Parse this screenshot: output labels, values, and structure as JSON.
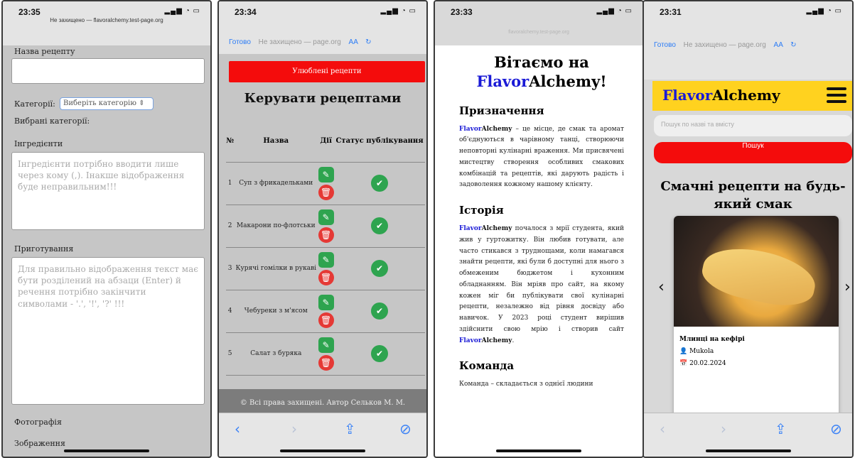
{
  "phone1": {
    "time": "23:35",
    "url": "Не захищено — flavoralchemy.test-page.org",
    "recipe_name_label": "Назва рецепту",
    "category_label": "Категорії:",
    "category_select": "Виберіть категорію",
    "selected_categories_label": "Вибрані категорії:",
    "ingredients_label": "Інгредієнти",
    "ingredients_placeholder": "Інгредієнти потрібно вводити лише через кому (,). Інакше відображення буде неправильним!!!",
    "preparation_label": "Приготування",
    "preparation_placeholder": "Для правильно відображення текст має бути розділений на абзаци (Enter) й речення потрібно закінчити символами - '.', '!', '?' !!!",
    "photo_label": "Фотографія",
    "image_label": "Зображення"
  },
  "phone2": {
    "time": "23:34",
    "done": "Готово",
    "url": "Не захищено — page.org",
    "aa": "AA",
    "favorites_button": "Улюблені рецепти",
    "title": "Керувати рецептами",
    "headers": [
      "№",
      "Назва",
      "Дії",
      "Статус публікування"
    ],
    "rows": [
      {
        "n": "1",
        "name": "Суп з фрикадельками"
      },
      {
        "n": "2",
        "name": "Макарони по-флотськи"
      },
      {
        "n": "3",
        "name": "Курячі гомілки в рукаві"
      },
      {
        "n": "4",
        "name": "Чебуреки з м'ясом"
      },
      {
        "n": "5",
        "name": "Салат з буряка"
      }
    ],
    "footer": "© Всі права захищені. Автор Сельков М. М."
  },
  "phone3": {
    "time": "23:33",
    "url": "flavoralchemy.test-page.org",
    "welcome": "Вітаємо на",
    "brand_flavor": "Flavor",
    "brand_alchemy": "Alchemy!",
    "purpose_heading": "Призначення",
    "purpose_text": " – це місце, де смак та аромат об'єднуються в чарівному танці, створюючи неповторні кулінарні враження. Ми присвячені мистецтву створення особливих смакових комбінацій та рецептів, які дарують радість і задоволення кожному нашому клієнту.",
    "history_heading": "Історія",
    "history_text_1": " почалося з мрії студента, який жив у гуртожитку. Він любив готувати, але часто стикався з труднощами, коли намагався знайти рецепти, які були б доступні для нього з обмеженим бюджетом і кухонним обладнанням. Він мріяв про сайт, на якому кожен міг би публікувати свої кулінарні рецепти, незалежно від рівня досвіду або навичок. У 2023 році студент вирішив здійснити свою мрію і створив сайт ",
    "history_text_2": ".",
    "team_heading": "Команда",
    "team_text": "Команда – складається з однієї людини",
    "brand_flavor_short": "Flavor",
    "brand_alchemy_short": "Alchemy"
  },
  "phone4": {
    "time": "23:31",
    "done": "Готово",
    "url": "Не захищено — page.org",
    "aa": "AA",
    "logo": "FlavorAlchemy",
    "search_placeholder": "Пошук по назві та вмісту",
    "search_button": "Пошук",
    "slogan": "Смачні рецепти на будь-який смак",
    "card_title": "Млинці на кефірі",
    "card_author": "Mukola",
    "card_date": "20.02.2024"
  },
  "colors": {
    "accent_red": "#f40c0c",
    "header_yellow": "#ffd21f",
    "brand_blue": "#1a1ad6",
    "ios_blue": "#2b7cf6"
  },
  "icons": [
    "pencil-square-icon",
    "trash-icon",
    "check-circle-icon",
    "user-icon",
    "calendar-icon",
    "share-icon",
    "compass-icon",
    "reload-icon",
    "burger-menu-icon"
  ]
}
